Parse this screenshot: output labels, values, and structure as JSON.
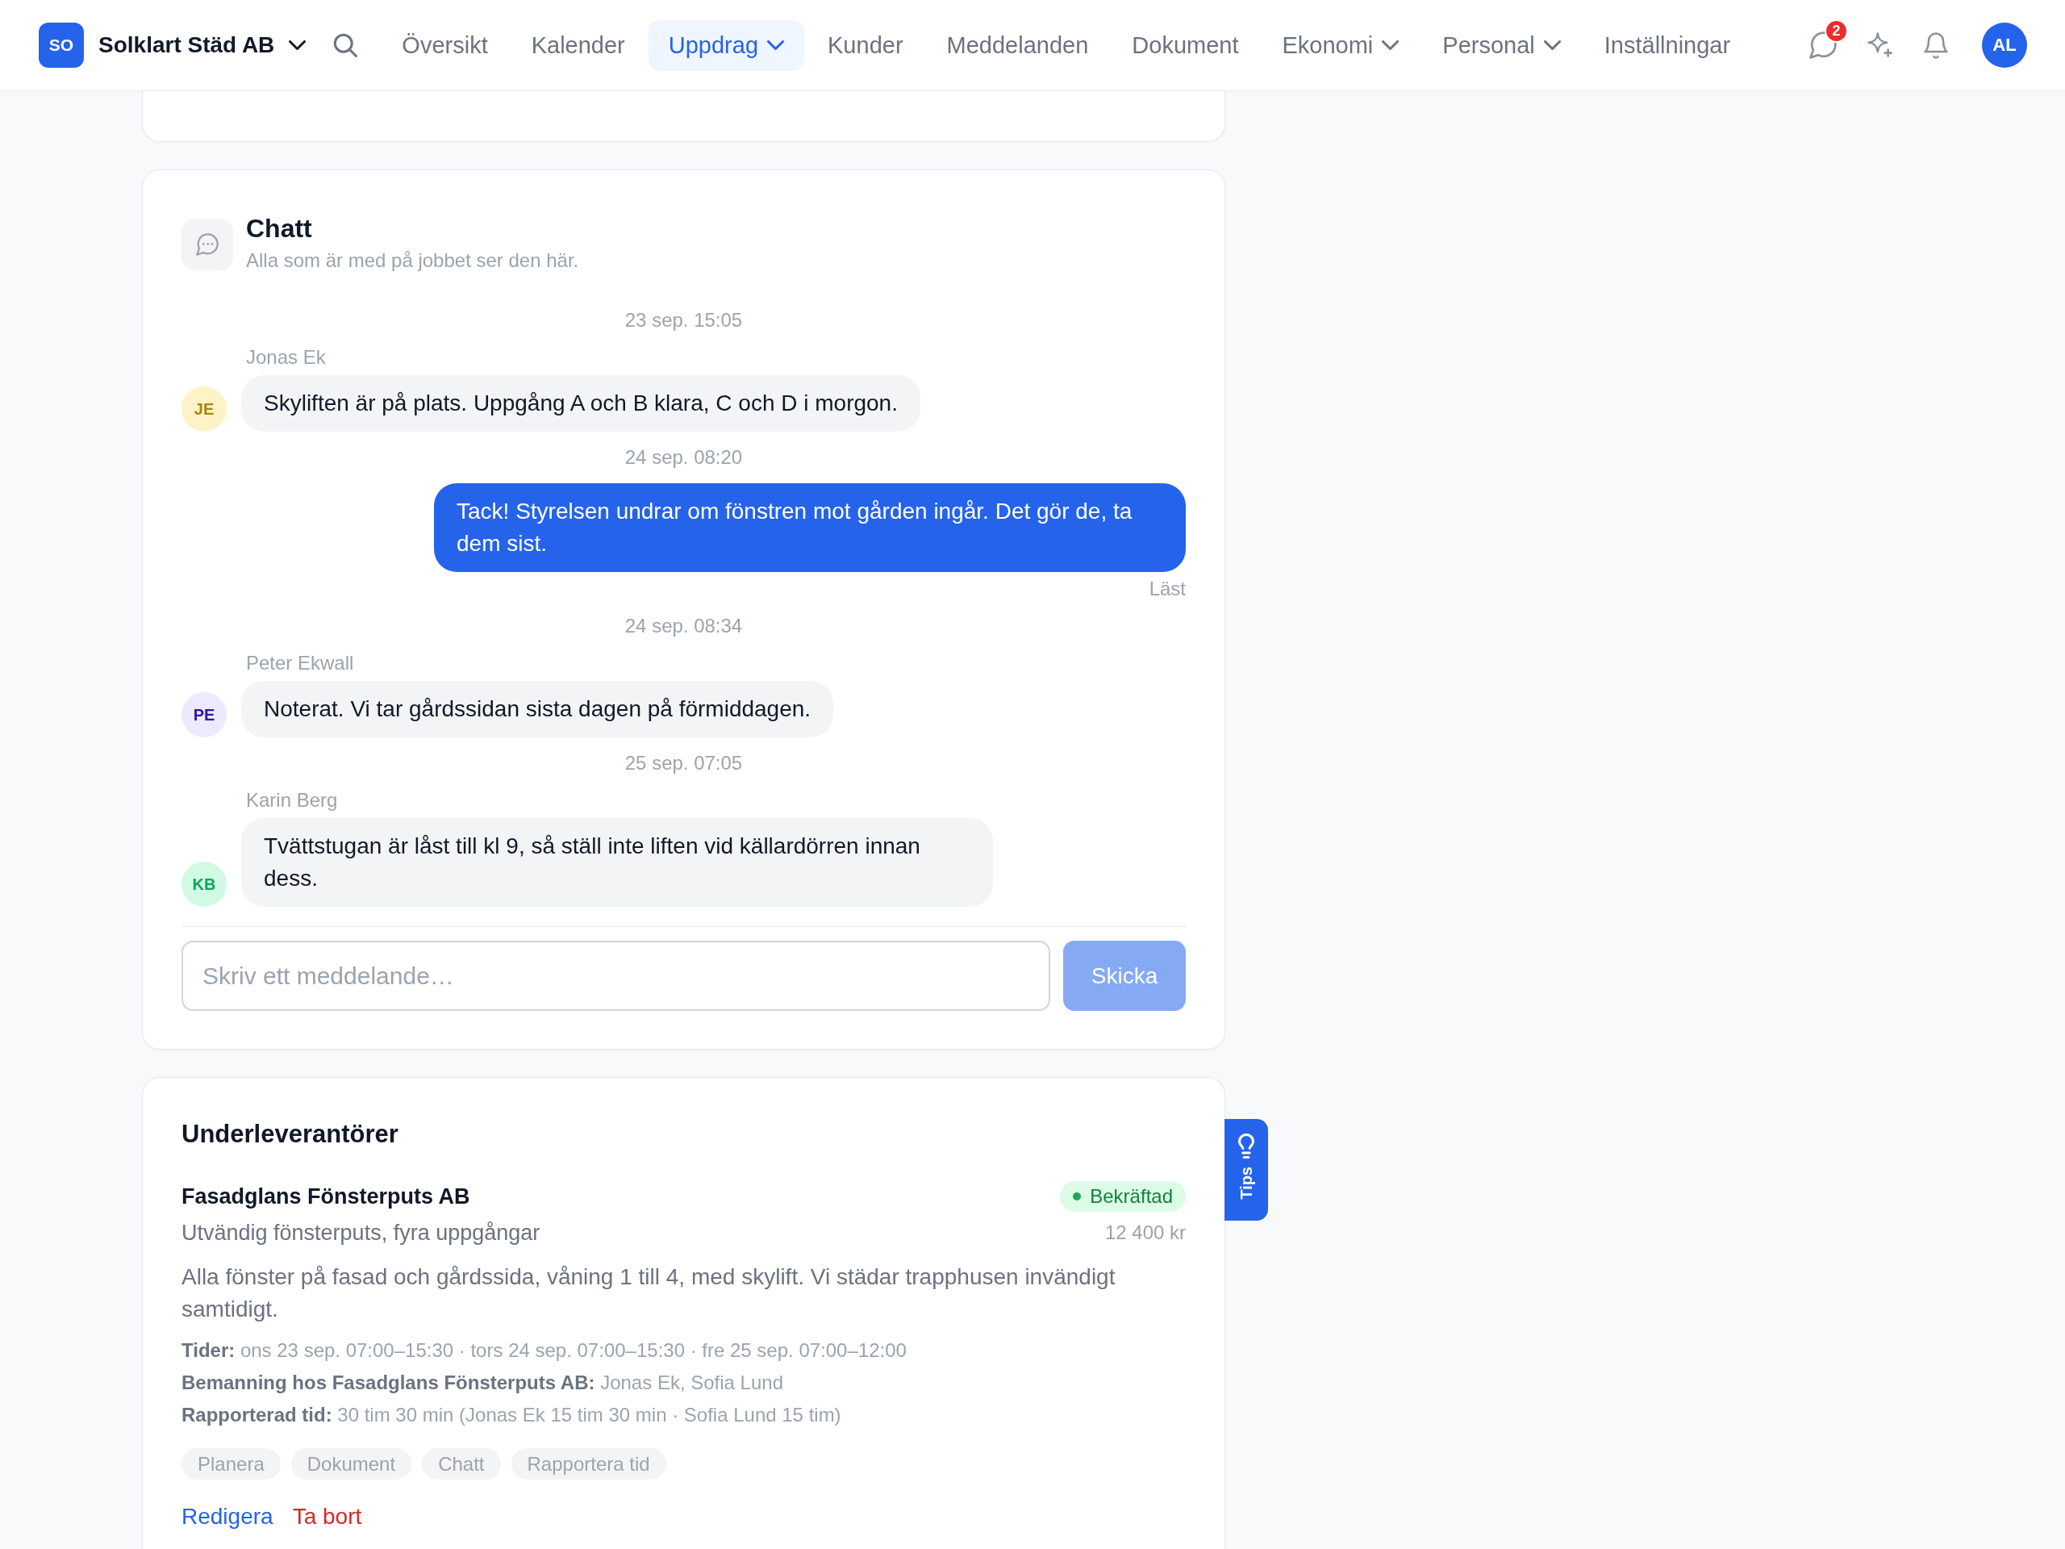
{
  "header": {
    "brand": {
      "initials": "SO",
      "name": "Solklart Städ AB"
    },
    "nav": [
      {
        "label": "Översikt",
        "selected": false,
        "dropdown": false
      },
      {
        "label": "Kalender",
        "selected": false,
        "dropdown": false
      },
      {
        "label": "Uppdrag",
        "selected": true,
        "dropdown": true
      },
      {
        "label": "Kunder",
        "selected": false,
        "dropdown": false
      },
      {
        "label": "Meddelanden",
        "selected": false,
        "dropdown": false
      },
      {
        "label": "Dokument",
        "selected": false,
        "dropdown": false
      },
      {
        "label": "Ekonomi",
        "selected": false,
        "dropdown": true
      },
      {
        "label": "Personal",
        "selected": false,
        "dropdown": true
      },
      {
        "label": "Inställningar",
        "selected": false,
        "dropdown": false
      }
    ],
    "messages_badge": "2",
    "user": {
      "initials": "AL"
    }
  },
  "chat": {
    "title": "Chatt",
    "subtitle": "Alla som är med på jobbet ser den här.",
    "messages": [
      {
        "time": "23 sep. 15:05",
        "kind": "incoming",
        "sender": "Jonas Ek",
        "initials": "JE",
        "color": "#fef3c7",
        "text": "Skyliften är på plats. Uppgång A och B klara, C och D i morgon."
      },
      {
        "time": "24 sep. 08:20",
        "kind": "outgoing",
        "text": "Tack! Styrelsen undrar om fönstren mot gården ingår. Det gör de, ta dem sist.",
        "receipt": "Läst"
      },
      {
        "time": "24 sep. 08:34",
        "kind": "incoming",
        "sender": "Peter Ekwall",
        "initials": "PE",
        "color": "#ede9fe",
        "text": "Noterat. Vi tar gårdssidan sista dagen på förmiddagen."
      },
      {
        "time": "25 sep. 07:05",
        "kind": "incoming",
        "sender": "Karin Berg",
        "initials": "KB",
        "color": "#d1fae5",
        "text": "Tvättstugan är låst till kl 9, så ställ inte liften vid källardörren innan dess."
      }
    ],
    "composer": {
      "placeholder": "Skriv ett meddelande…",
      "send": {
        "label": "Skicka",
        "disabled": true
      }
    }
  },
  "subcontractors": {
    "title": "Underleverantörer",
    "items": [
      {
        "name": "Fasadglans Fönsterputs AB",
        "status": {
          "label": "Bekräftad",
          "kind": "confirmed"
        },
        "service": "Utvändig fönsterputs, fyra uppgångar",
        "price": "12 400 kr",
        "description": "Alla fönster på fasad och gårdssida, våning 1 till 4, med skylift. Vi städar trapphusen invändigt samtidigt.",
        "details": [
          "**Tider:** ons 23 sep. 07:00–15:30 · tors 24 sep. 07:00–15:30 · fre 25 sep. 07:00–12:00",
          "**Bemanning hos Fasadglans Fönsterputs AB:** Jonas Ek, Sofia Lund",
          "**Rapporterad tid:** 30 tim 30 min (Jonas Ek 15 tim 30 min · Sofia Lund 15 tim)"
        ],
        "actions": [
          {
            "label": "Planera",
            "disabled": true
          },
          {
            "label": "Dokument",
            "disabled": true
          },
          {
            "label": "Chatt",
            "disabled": true
          },
          {
            "label": "Rapportera tid",
            "disabled": true
          }
        ],
        "links": [
          {
            "label": "Redigera",
            "kind": "edit"
          },
          {
            "label": "Ta bort",
            "kind": "delete"
          }
        ]
      }
    ]
  },
  "tips_tab": {
    "label": "Tips"
  }
}
